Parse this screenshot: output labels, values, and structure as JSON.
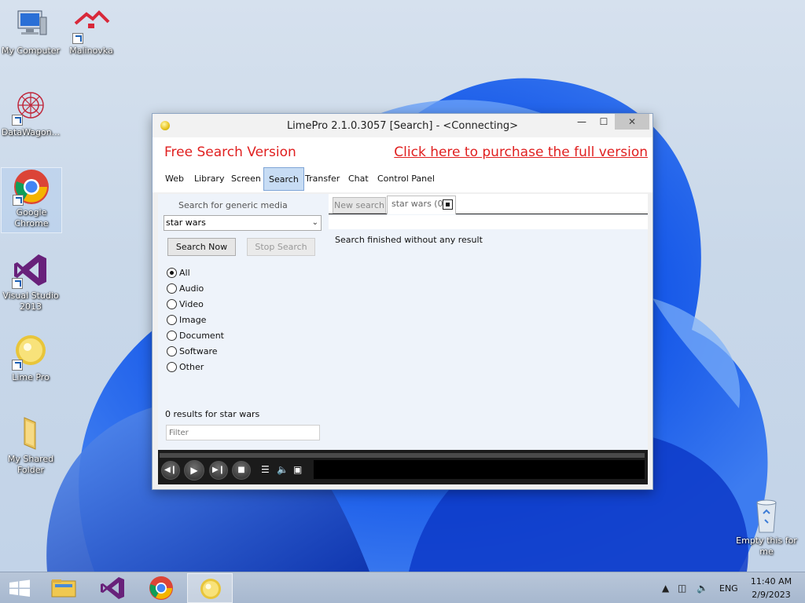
{
  "desktop": {
    "icons": [
      {
        "label": "My Computer"
      },
      {
        "label": "Malinovka"
      },
      {
        "label": "DataWagon..."
      },
      {
        "label": "Google Chrome"
      },
      {
        "label": "Visual Studio 2013"
      },
      {
        "label": "Lime Pro"
      },
      {
        "label": "My Shared Folder"
      },
      {
        "label": "Empty this for me"
      }
    ]
  },
  "window": {
    "title": "LimePro 2.1.0.3057   [Search]   -   <Connecting>",
    "controls": {
      "minimize": "—",
      "maximize": "☐",
      "close": "✕"
    },
    "banner": {
      "left": "Free Search Version",
      "right": "Click here to purchase the full version"
    },
    "menu": [
      "Web",
      "Library",
      "Screen",
      "Search",
      "Transfer",
      "Chat",
      "Control Panel"
    ],
    "active_menu": "Search",
    "left_panel": {
      "search_type_label": "Search for generic media",
      "query_value": "star wars",
      "search_now": "Search Now",
      "stop_search": "Stop Search",
      "media_types": [
        "All",
        "Audio",
        "Video",
        "Image",
        "Document",
        "Software",
        "Other"
      ],
      "selected_media_type": "All",
      "results_count": "0 results for star wars",
      "filter_placeholder": "Filter"
    },
    "right_panel": {
      "new_search_tab": "New search",
      "active_tab": "star wars (0)",
      "result_message": "Search finished without any result"
    }
  },
  "taskbar": {
    "tray": {
      "language": "ENG",
      "time": "11:40 AM",
      "date": "2/9/2023"
    }
  },
  "colors": {
    "banner_red": "#e01f1f",
    "active_menu_bg": "#c7dcf4",
    "panel_bg": "#eef3fa",
    "taskbar_bg": "#b8c6d9"
  }
}
